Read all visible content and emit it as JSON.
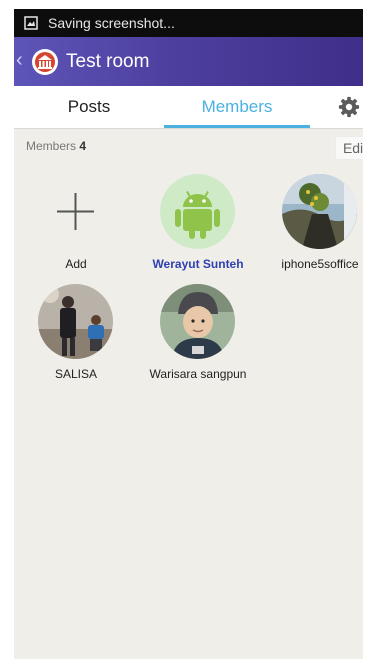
{
  "status_bar": {
    "text": "Saving screenshot...",
    "icon": "screenshot-icon"
  },
  "app_bar": {
    "back_icon": "chevron-left-icon",
    "room_icon": "building-icon",
    "title": "Test room"
  },
  "tabs": {
    "posts": "Posts",
    "members": "Members",
    "settings_icon": "gear-icon",
    "active": "members"
  },
  "members_header": {
    "label": "Members",
    "count": "4",
    "edit_label": "Edit"
  },
  "members": [
    {
      "name": "Add",
      "avatar": "plus-icon"
    },
    {
      "name": "Werayut Sunteh",
      "avatar": "android-icon",
      "is_self": true
    },
    {
      "name": "iphone5soffice",
      "avatar": "photo-tree"
    },
    {
      "name": "SALISA",
      "avatar": "photo-people"
    },
    {
      "name": "Warisara  sangpun",
      "avatar": "photo-portrait"
    }
  ],
  "colors": {
    "accent": "#4ab1e1",
    "app_bar": "#4d3f9e",
    "self_name": "#2f3fb0",
    "android_green": "#8fc34a"
  }
}
